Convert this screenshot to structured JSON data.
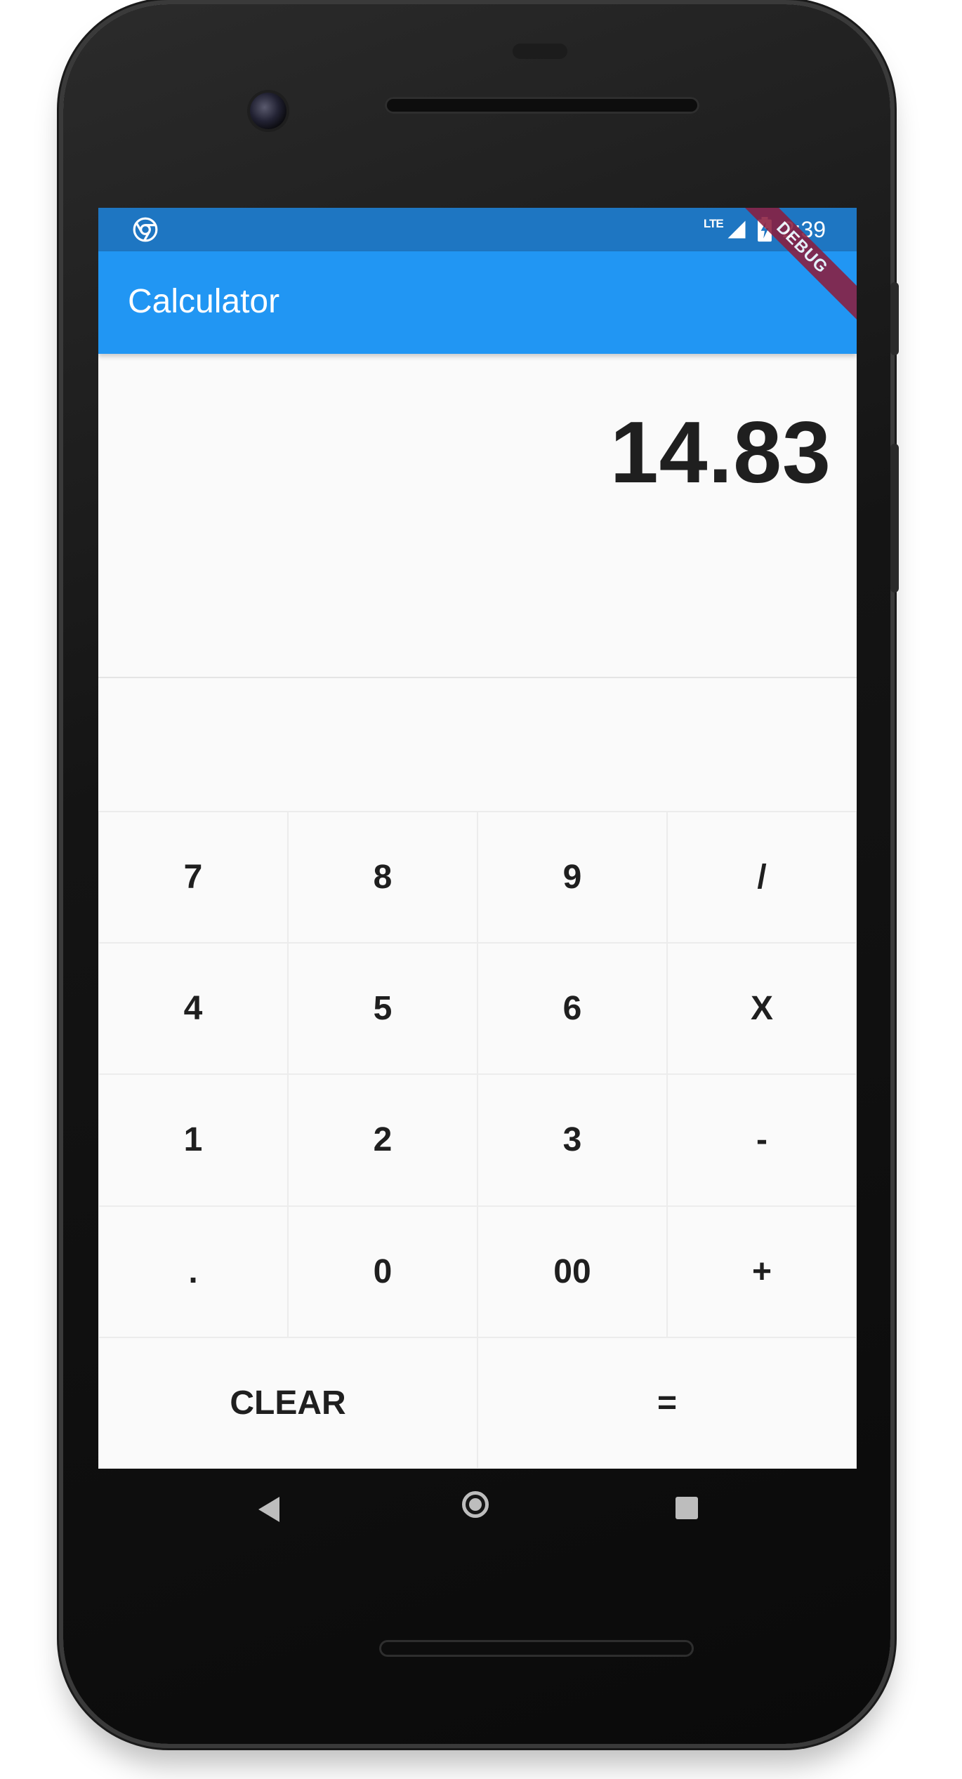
{
  "status_bar": {
    "network": "LTE",
    "time": "2:39",
    "left_icon": "chrome-icon",
    "battery_icon": "battery-charging-icon",
    "signal_icon": "signal-icon"
  },
  "app_bar": {
    "title": "Calculator",
    "debug_banner": "DEBUG"
  },
  "display": {
    "value": "14.83"
  },
  "keypad": {
    "rows": [
      [
        "7",
        "8",
        "9",
        "/"
      ],
      [
        "4",
        "5",
        "6",
        "X"
      ],
      [
        "1",
        "2",
        "3",
        "-"
      ],
      [
        ".",
        "0",
        "00",
        "+"
      ],
      [
        "CLEAR",
        "="
      ]
    ]
  },
  "nav_bar": {
    "back_icon": "back-triangle-icon",
    "home_icon": "home-circle-icon",
    "recents_icon": "recents-square-icon"
  },
  "colors": {
    "status_bar": "#1e76c2",
    "app_bar": "#2196f3",
    "debug_banner": "#8b1e3f",
    "background": "#fafafa",
    "text": "#1f1f1f"
  }
}
